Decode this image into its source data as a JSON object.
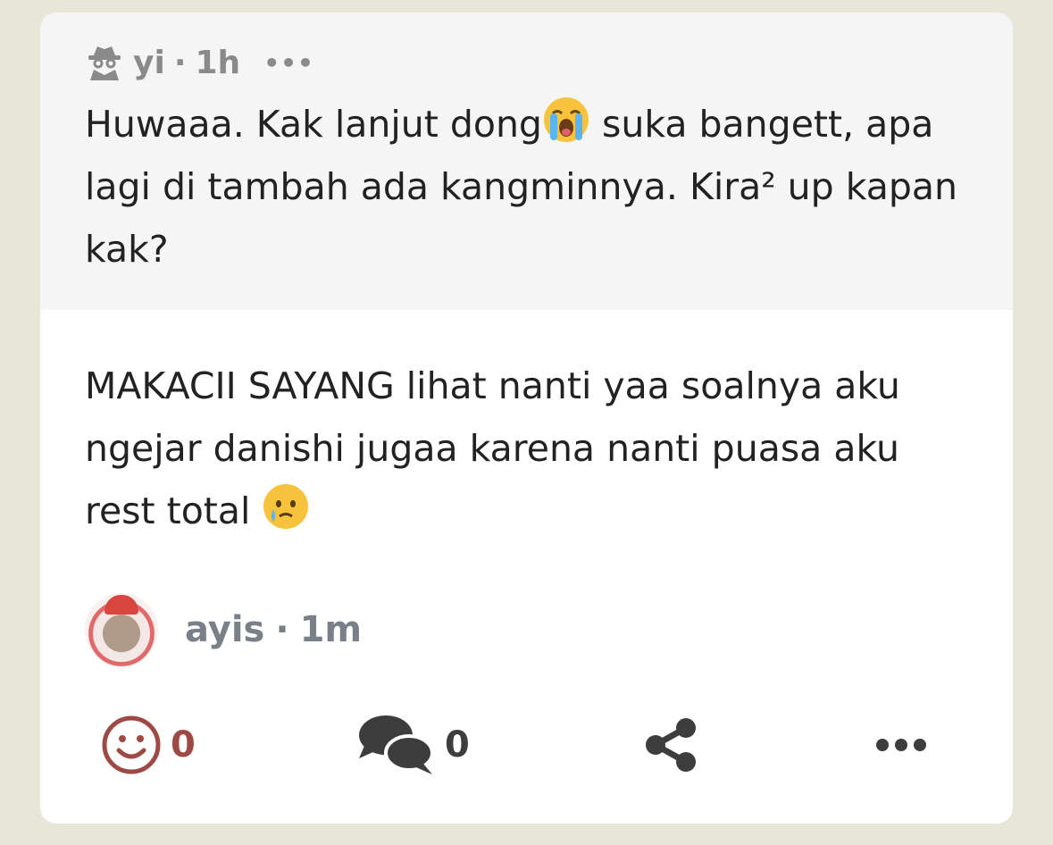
{
  "quoted": {
    "username": "yi",
    "separator": "·",
    "time": "1h",
    "more_label": "•••",
    "text": "Huwaaa. Kak lanjut dong",
    "text_rest": " suka bangett, apa lagi di tambah ada kangminnya. Kira² up kapan kak?"
  },
  "reply": {
    "text": "MAKACII SAYANG lihat nanti yaa soalnya aku ngejar danishi jugaa karena nanti puasa aku rest total "
  },
  "author": {
    "username": "ayis",
    "separator": "·",
    "time": "1m"
  },
  "actions": {
    "reactions_count": "0",
    "comments_count": "0"
  },
  "colors": {
    "reaction": "#9c4a43",
    "icons": "#3d3d3d",
    "meta": "#8a8a8a"
  }
}
